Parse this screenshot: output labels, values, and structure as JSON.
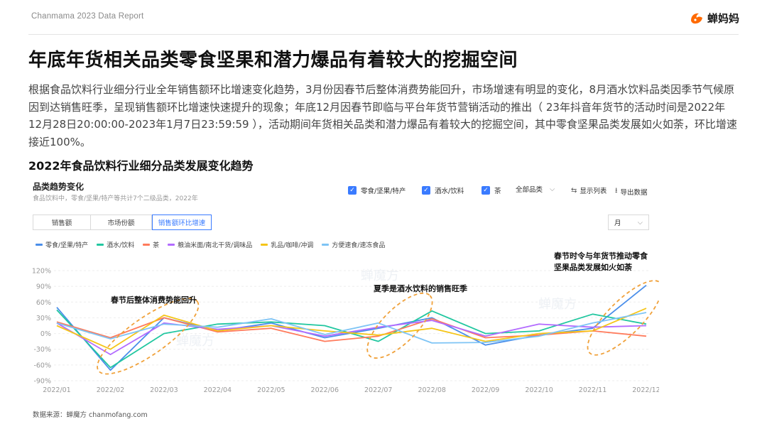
{
  "header": {
    "report_title": "Chanmama 2023 Data Report",
    "brand_name": "蝉妈妈",
    "brand_color": "#ff6a00"
  },
  "headline": "年底年货相关品类零食坚果和潜力爆品有着较大的挖掘空间",
  "body_text": "根据食品饮料行业细分行业全年销售额环比增速变化趋势，3月份因春节后整体消费势能回升，市场增速有明显的变化，8月酒水饮料品类因季节气候原因到达销售旺季，呈现销售额环比增速快速提升的现象；年底12月因春节即临与平台年货节营销活动的推出（ 23年抖音年货节的活动时间是2022年12月28日20:00:00-2023年1月7日23:59:59 ），活动期间年货相关品类和潜力爆品有着较大的挖掘空间，其中零食坚果品类发展如火如荼，环比增速接近100%。",
  "sub_heading": "2022年食品饮料行业细分品类发展变化趋势",
  "panel": {
    "title": "品类趋势变化",
    "subtitle": "食品饮料中，零食/坚果/特产等共计7个二级品类，2022年",
    "filters": [
      {
        "label": "零食/坚果/特产",
        "checked": true
      },
      {
        "label": "酒水/饮料",
        "checked": true
      },
      {
        "label": "茶",
        "checked": true
      }
    ],
    "select_all": "全部品类",
    "select_arrow": "⌵",
    "tools": {
      "list_icon": "list-icon",
      "list_label": "显示列表",
      "export_icon": "export-icon",
      "export_label": "导出数据"
    },
    "tabs": [
      "销售额",
      "市场份额",
      "销售额环比增速"
    ],
    "active_tab": 2,
    "period": "月",
    "period_arrow": "⌵"
  },
  "watermark": "蝉魔方",
  "source": "数据来源：蝉魔方 chanmofang.com",
  "chart_data": {
    "type": "line",
    "title": "",
    "x": [
      "2022/01",
      "2022/02",
      "2022/03",
      "2022/04",
      "2022/05",
      "2022/06",
      "2022/07",
      "2022/08",
      "2022/09",
      "2022/10",
      "2022/11",
      "2022/12"
    ],
    "ylim": [
      -90,
      120
    ],
    "yticks": [
      120,
      90,
      60,
      30,
      0,
      -30,
      -60,
      -90
    ],
    "ytick_labels": [
      "120%",
      "90%",
      "60%",
      "30%",
      "0%",
      "-30%",
      "-60%",
      "-90%"
    ],
    "grid": true,
    "legend_position": "top-left",
    "series": [
      {
        "name": "零食/坚果/特产",
        "color": "#4a8eea",
        "values": [
          50,
          -70,
          30,
          5,
          20,
          -8,
          10,
          30,
          -22,
          -3,
          10,
          92
        ]
      },
      {
        "name": "酒水/饮料",
        "color": "#22c7a0",
        "values": [
          45,
          -65,
          0,
          18,
          22,
          15,
          -15,
          43,
          0,
          5,
          37,
          18
        ]
      },
      {
        "name": "茶",
        "color": "#ff7b5c",
        "values": [
          22,
          -8,
          30,
          3,
          10,
          -15,
          -5,
          28,
          -8,
          -3,
          5,
          -5
        ]
      },
      {
        "name": "粮油米面/南北干货/调味品",
        "color": "#b36bff",
        "values": [
          20,
          -40,
          20,
          8,
          15,
          -5,
          12,
          25,
          -5,
          18,
          12,
          15
        ]
      },
      {
        "name": "乳品/咖啡/冲调",
        "color": "#f5c518",
        "values": [
          15,
          -30,
          35,
          5,
          15,
          5,
          -3,
          10,
          -15,
          0,
          5,
          48
        ]
      },
      {
        "name": "方便速食/速冻食品",
        "color": "#7ec4f5",
        "values": [
          20,
          -10,
          18,
          12,
          28,
          -2,
          20,
          -18,
          -17,
          -5,
          20,
          40
        ]
      }
    ],
    "annotations": [
      {
        "text": "春节后整体消费势能回升",
        "x": "2022/03",
        "y": 0
      },
      {
        "text": "夏季是酒水饮料的销售旺季",
        "x": "2022/07",
        "y": 20
      },
      {
        "text": "春节时令与年货节推动零食坚果品类发展如火如荼",
        "x": "2022/12",
        "y": 60
      }
    ],
    "annotation_lines": [
      "春节时令与年货节推动零食",
      "坚果品类发展如火如荼"
    ],
    "highlight_ellipse_color": "#f0a13a"
  }
}
